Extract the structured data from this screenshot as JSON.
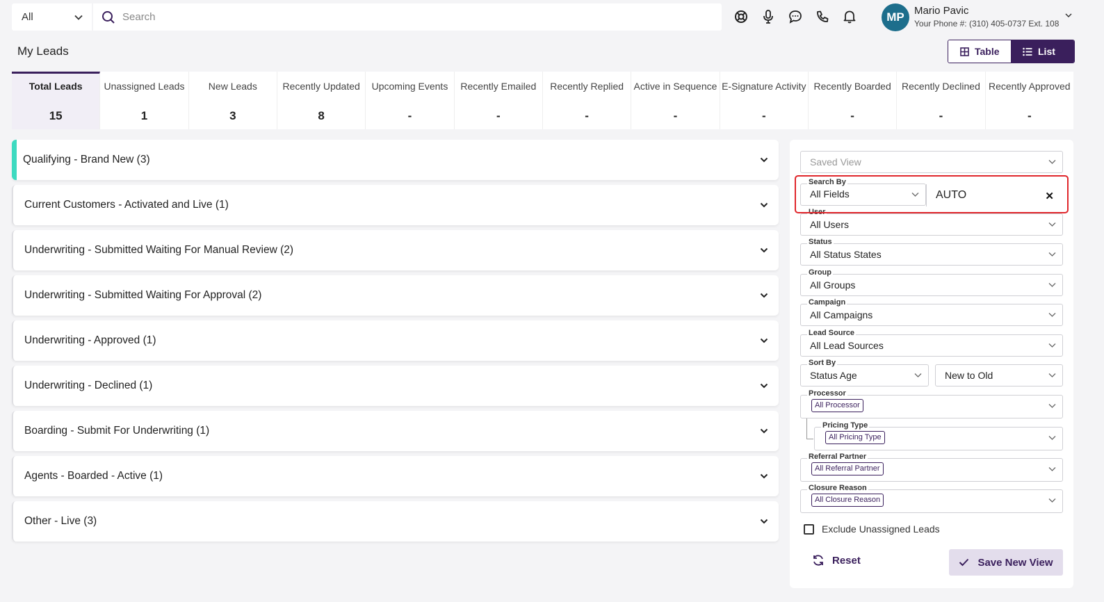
{
  "topbar": {
    "scope": "All",
    "search_placeholder": "Search",
    "icons": [
      "support-icon",
      "microphone-icon",
      "chat-icon",
      "phone-icon",
      "bell-icon"
    ],
    "user": {
      "initials": "MP",
      "name": "Mario Pavic",
      "phone": "Your Phone #: (310) 405-0737 Ext. 108"
    }
  },
  "header": {
    "title": "My Leads",
    "view_table": "Table",
    "view_list": "List"
  },
  "stats": [
    {
      "label": "Total Leads",
      "value": "15",
      "active": true
    },
    {
      "label": "Unassigned Leads",
      "value": "1"
    },
    {
      "label": "New Leads",
      "value": "3"
    },
    {
      "label": "Recently Updated",
      "value": "8"
    },
    {
      "label": "Upcoming Events",
      "value": "-"
    },
    {
      "label": "Recently Emailed",
      "value": "-"
    },
    {
      "label": "Recently Replied",
      "value": "-"
    },
    {
      "label": "Active in Sequence",
      "value": "-"
    },
    {
      "label": "E-Signature Activity",
      "value": "-"
    },
    {
      "label": "Recently Boarded",
      "value": "-"
    },
    {
      "label": "Recently Declined",
      "value": "-"
    },
    {
      "label": "Recently Approved",
      "value": "-"
    }
  ],
  "groups": [
    "Qualifying - Brand New (3)",
    "Current Customers - Activated and Live (1)",
    "Underwriting - Submitted Waiting For Manual Review (2)",
    "Underwriting - Submitted Waiting For Approval (2)",
    "Underwriting - Approved (1)",
    "Underwriting - Declined (1)",
    "Boarding - Submit For Underwriting (1)",
    "Agents - Boarded - Active (1)",
    "Other - Live (3)"
  ],
  "filters": {
    "saved_view": "Saved View",
    "search_by": {
      "label": "Search By",
      "value": "All Fields",
      "query": "AUTO"
    },
    "user": {
      "label": "User",
      "value": "All Users"
    },
    "status": {
      "label": "Status",
      "value": "All Status States"
    },
    "group": {
      "label": "Group",
      "value": "All Groups"
    },
    "campaign": {
      "label": "Campaign",
      "value": "All Campaigns"
    },
    "lead_source": {
      "label": "Lead Source",
      "value": "All Lead Sources"
    },
    "sort_by": {
      "label": "Sort By",
      "value": "Status Age",
      "order": "New to Old"
    },
    "processor": {
      "label": "Processor",
      "chip": "All Processor"
    },
    "pricing_type": {
      "label": "Pricing Type",
      "chip": "All Pricing Type"
    },
    "referral_partner": {
      "label": "Referral Partner",
      "chip": "All Referral Partner"
    },
    "closure_reason": {
      "label": "Closure Reason",
      "chip": "All Closure Reason"
    },
    "exclude_unassigned": "Exclude Unassigned Leads",
    "reset": "Reset",
    "save_new_view": "Save New View"
  }
}
